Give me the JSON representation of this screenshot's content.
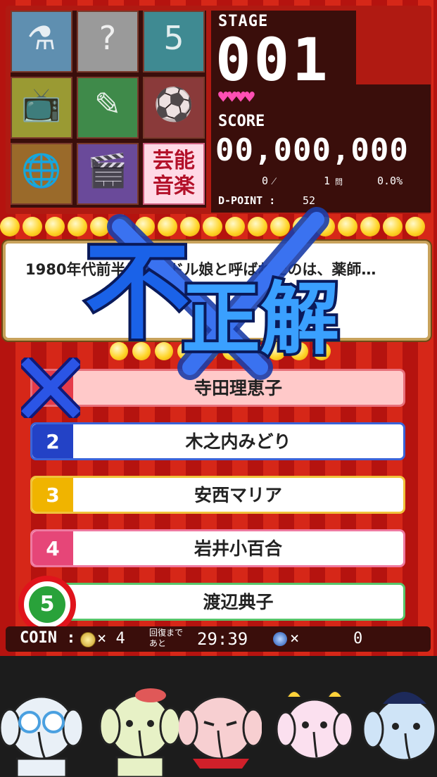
{
  "colors": {
    "accent_pink": "#ff4fb4",
    "wrong_red": "#e0141c",
    "panel_dark": "#3a0e0b"
  },
  "categories": [
    {
      "name": "science",
      "icon": "flask-magnifier-icon",
      "color": "#5f8fb0"
    },
    {
      "name": "quiz",
      "icon": "question-marks-icon",
      "color": "#9a9a9a"
    },
    {
      "name": "math",
      "icon": "numbers-icon",
      "color": "#3f8a92"
    },
    {
      "name": "tv",
      "icon": "television-icon",
      "color": "#9a9a33"
    },
    {
      "name": "literature",
      "icon": "book-pen-icon",
      "color": "#3f8a4a"
    },
    {
      "name": "sports",
      "icon": "ball-bat-icon",
      "color": "#8a3a3a"
    },
    {
      "name": "geography",
      "icon": "globe-person-icon",
      "color": "#9a6a2a"
    },
    {
      "name": "movie",
      "icon": "clapperboard-icon",
      "color": "#6a4a9a"
    },
    {
      "name": "geinou",
      "icon": "entertainment-music-tile",
      "label": "芸能\n音楽"
    }
  ],
  "stage": {
    "label": "STAGE",
    "value": "001"
  },
  "lives": {
    "icon": "heart-icon",
    "count": 4,
    "symbols": "♥♥♥♥"
  },
  "score": {
    "label": "SCORE",
    "value": "00,000,000"
  },
  "stats": {
    "correct": "0",
    "slash": "⁄",
    "total": "1",
    "total_unit": "問",
    "rate": "0.0%"
  },
  "dpoint": {
    "label": "D-POINT :",
    "value": "52"
  },
  "question": {
    "text": "1980年代前半にアイドル娘と呼ばれたのは、薬師…"
  },
  "result": {
    "label_1": "不",
    "label_2": "正解"
  },
  "answers": [
    {
      "num": "1",
      "text": "寺田理恵子",
      "num_color": "#e53b4a",
      "bg": "#ffc9c9",
      "border": "#e8707a"
    },
    {
      "num": "2",
      "text": "木之内みどり",
      "num_color": "#2342c6",
      "bg": "#ffffff",
      "border": "#3b63d8"
    },
    {
      "num": "3",
      "text": "安西マリア",
      "num_color": "#f0b400",
      "bg": "#ffffff",
      "border": "#f0c23a"
    },
    {
      "num": "4",
      "text": "岩井小百合",
      "num_color": "#e64678",
      "bg": "#ffffff",
      "border": "#ef7aa0"
    },
    {
      "num": "5",
      "text": "渡辺典子",
      "num_color": "#29a23a",
      "bg": "#ffffff",
      "border": "#58c46a"
    }
  ],
  "status": {
    "coin_label": "COIN :",
    "coin_icon": "coin-icon",
    "coin_count": "× 4",
    "recovery_label_1": "回復まで",
    "recovery_label_2": "あと",
    "timer": "29:39",
    "item_icon": "blue-gem-icon",
    "item_count": "×",
    "item_value": "0"
  },
  "characters": [
    {
      "name": "dizzy-elephant",
      "color": "#e9f0f7"
    },
    {
      "name": "green-elephant",
      "color": "#e7f1c6"
    },
    {
      "name": "pink-elephant",
      "color": "#f7cfd1"
    },
    {
      "name": "ribbon-elephant",
      "color": "#fbe0ef"
    },
    {
      "name": "blue-elephant",
      "color": "#cfe4f7"
    }
  ]
}
